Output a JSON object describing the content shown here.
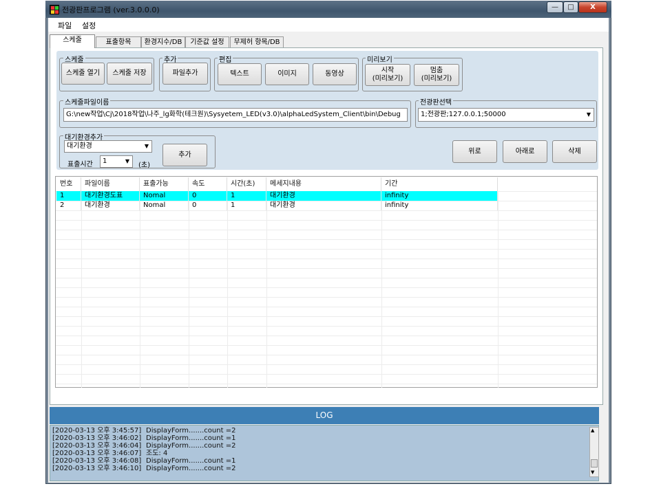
{
  "window": {
    "title": "전광판프로그램 (ver.3.0.0.0)",
    "minimize": "—",
    "maximize": "□",
    "close": "X"
  },
  "menu": [
    "파일",
    "설정"
  ],
  "tabs": [
    "스케줄",
    "표출항목",
    "환경지수/DB",
    "기준값 설정",
    "무제허 항목/DB"
  ],
  "groups": {
    "schedule": {
      "title": "스케줄",
      "open": "스케줄 열기",
      "save": "스케줄 저장"
    },
    "add": {
      "title": "추가",
      "add_file": "파일추가"
    },
    "edit": {
      "title": "편집",
      "text": "텍스트",
      "image": "이미지",
      "video": "동영상"
    },
    "preview": {
      "title": "미리보기",
      "start_l1": "시작",
      "start_l2": "(미리보기)",
      "stop_l1": "멈춤",
      "stop_l2": "(미리보기)"
    },
    "schedule_file": {
      "title": "스케줄파일이름",
      "value": "G:\\new작업\\Cj\\2018작업\\나주_lg화학(테크원)\\Sysyetem_LED(v3.0)\\alphaLedSystem_Client\\bin\\Debug"
    },
    "board": {
      "title": "전광판선택",
      "value": "1;전광판;127.0.0.1;50000"
    },
    "idle_add": {
      "title": "대기환경추가",
      "select_value": "대기환경",
      "time_label": "표출시간",
      "time_value": "1",
      "time_unit": "(초)",
      "add_button": "추가"
    }
  },
  "order_buttons": {
    "up": "위로",
    "down": "아래로",
    "delete": "삭제"
  },
  "table": {
    "columns": [
      "번호",
      "파일이름",
      "표출가능",
      "속도",
      "시간(초)",
      "메세지내용",
      "기간"
    ],
    "rows": [
      [
        "1",
        "대기환경도표",
        "Nomal",
        "0",
        "1",
        "대기환경",
        "infinity"
      ],
      [
        "2",
        "대기환경",
        "Nomal",
        "0",
        "1",
        "대기환경",
        "infinity"
      ]
    ],
    "selected_row": 0,
    "selected_color": "#00ffff"
  },
  "log": {
    "title": "LOG",
    "lines": [
      {
        "time": "[2020-03-13 오후 3:45:57]",
        "msg": "DisplayForm.......count =2"
      },
      {
        "time": "[2020-03-13 오후 3:46:02]",
        "msg": "DisplayForm.......count =1"
      },
      {
        "time": "[2020-03-13 오후 3:46:04]",
        "msg": "DisplayForm.......count =2"
      },
      {
        "time": "[2020-03-13 오후 3:46:07]",
        "msg": "조도: 4"
      },
      {
        "time": "[2020-03-13 오후 3:46:08]",
        "msg": "DisplayForm.......count =1"
      },
      {
        "time": "[2020-03-13 오후 3:46:10]",
        "msg": "DisplayForm.......count =2"
      }
    ]
  },
  "icons": {
    "dropdown": "▼",
    "scroll_up": "▲",
    "scroll_down": "▼"
  }
}
